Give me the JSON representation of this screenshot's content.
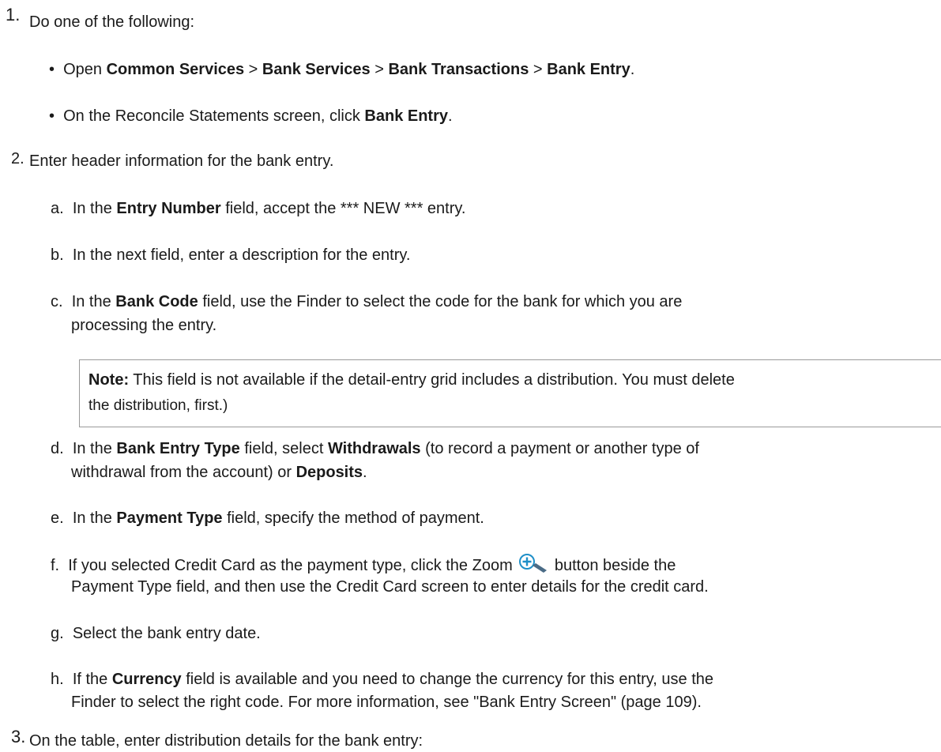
{
  "step1": {
    "num": "1.",
    "text": "Do one of the following:",
    "bullets": [
      {
        "pre": "Open ",
        "b1": "Common Services",
        "s1": " > ",
        "b2": "Bank Services",
        "s2": " > ",
        "b3": "Bank Transactions",
        "s3": " > ",
        "b4": "Bank Entry",
        "post": "."
      },
      {
        "pre": "On the Reconcile Statements screen, click ",
        "b1": "Bank Entry",
        "post": "."
      }
    ]
  },
  "step2": {
    "num": "2.",
    "text": "Enter header information for the bank entry.",
    "items": {
      "a": {
        "letter": "a.",
        "pre": "In the ",
        "bold": "Entry Number",
        "post": " field, accept the *** NEW *** entry."
      },
      "b": {
        "letter": "b.",
        "text": "In the next field, enter a description for the entry."
      },
      "c": {
        "letter": "c.",
        "pre": "In the ",
        "bold": "Bank Code",
        "post": " field, use the Finder to select the code for the bank for which you are",
        "line2": "processing the entry."
      },
      "note": {
        "label": "Note:",
        "text": " This field is not available if the detail-entry grid includes a distribution. You must delete",
        "line2": "the distribution, first.)"
      },
      "d": {
        "letter": "d.",
        "pre": "In the ",
        "bold": "Bank Entry Type",
        "mid": " field, select ",
        "bold2": "Withdrawals",
        "post": " (to record a payment or another type of",
        "line2_pre": "withdrawal from the account) or ",
        "line2_bold": "Deposits",
        "line2_post": "."
      },
      "e": {
        "letter": "e.",
        "pre": "In the ",
        "bold": "Payment Type",
        "post": " field, specify the method of payment."
      },
      "f": {
        "letter": "f.",
        "pre": "If you selected Credit Card as the payment type, click the Zoom ",
        "post": " button beside the",
        "line2": "Payment Type field, and then use the Credit Card screen to enter details for the credit card."
      },
      "g": {
        "letter": "g.",
        "text": "Select the bank entry date."
      },
      "h": {
        "letter": "h.",
        "pre": "If the ",
        "bold": "Currency",
        "post": " field is available and you need to change the currency for this entry, use the",
        "line2": "Finder to select the right code. For more information, see \"Bank Entry Screen\" (page 109)."
      }
    }
  },
  "step3": {
    "num": "3.",
    "text": "On the table, enter distribution details for the bank entry:"
  },
  "icons": {
    "zoom": "zoom-plus-icon",
    "accent": "#1e8fc8"
  }
}
